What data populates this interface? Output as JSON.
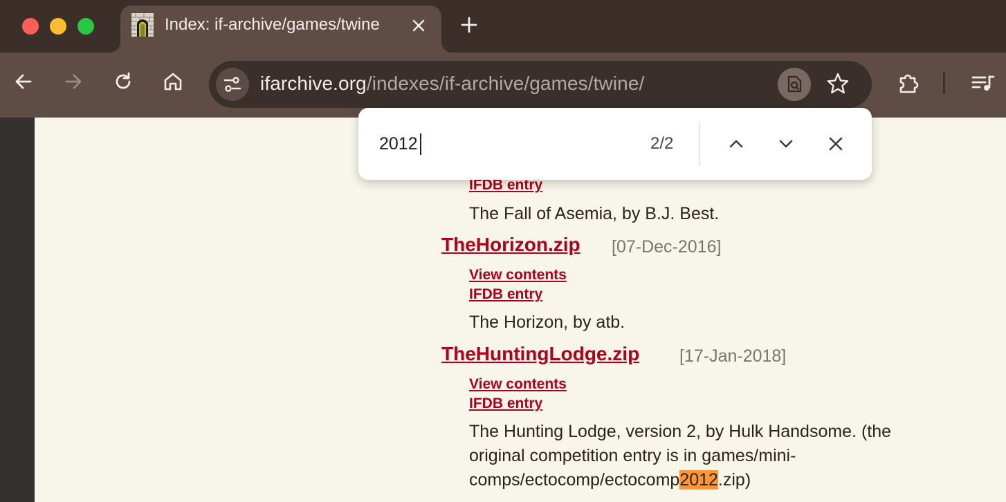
{
  "browser": {
    "tab": {
      "title": "Index: if-archive/games/twine"
    },
    "omnibox": {
      "domain": "ifarchive.org",
      "path": "/indexes/if-archive/games/twine/"
    }
  },
  "find_bar": {
    "query": "2012",
    "count": "2/2"
  },
  "page": {
    "top_entry": {
      "ifdb_label": "IFDB entry",
      "description": "The Fall of Asemia, by B.J. Best."
    },
    "entries": [
      {
        "filename": "TheHorizon.zip",
        "date": "[07-Dec-2016]",
        "view_contents_label": "View contents",
        "ifdb_label": "IFDB entry",
        "description": "The Horizon, by atb."
      },
      {
        "filename": "TheHuntingLodge.zip",
        "date": "[17-Jan-2018]",
        "view_contents_label": "View contents",
        "ifdb_label": "IFDB entry",
        "description_line1": "The Hunting Lodge, version 2, by Hulk Handsome. (the",
        "description_line2": "original competition entry is in games/mini-",
        "description_line3_pre": "comps/ectocomp/ectocomp",
        "description_line3_match": "2012",
        "description_line3_post": ".zip)"
      }
    ]
  },
  "colors": {
    "link": "#b0001a",
    "page_background": "#f8f5ea",
    "chrome_frame": "#3c2f2a",
    "chrome_toolbar": "#5f4d45",
    "find_highlight": "#ff9632"
  },
  "icons": [
    "tab-favicon-icon",
    "close-icon",
    "plus-icon",
    "back-arrow-icon",
    "forward-arrow-icon",
    "reload-icon",
    "home-icon",
    "site-settings-icon",
    "lens-search-icon",
    "bookmark-star-icon",
    "extensions-icon",
    "media-queue-icon",
    "chevron-up-icon",
    "chevron-down-icon",
    "find-close-icon"
  ]
}
